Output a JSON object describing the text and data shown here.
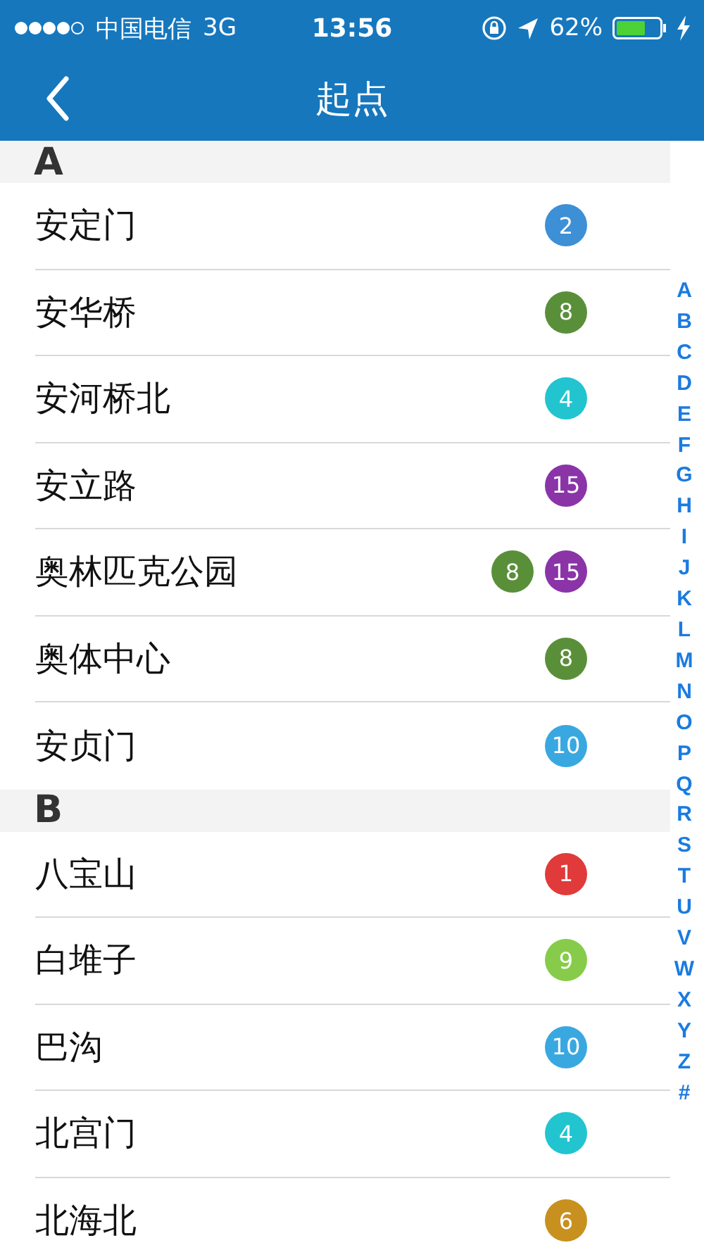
{
  "status_bar": {
    "carrier": "中国电信",
    "network": "3G",
    "time": "13:56",
    "battery": "62%"
  },
  "nav": {
    "title": "起点"
  },
  "sections": [
    {
      "letter": "A",
      "stations": [
        {
          "name": "安定门",
          "lines": [
            {
              "label": "2",
              "color": "#3d8fd6"
            }
          ]
        },
        {
          "name": "安华桥",
          "lines": [
            {
              "label": "8",
              "color": "#5a8f3a"
            }
          ]
        },
        {
          "name": "安河桥北",
          "lines": [
            {
              "label": "4",
              "color": "#22c4cf"
            }
          ]
        },
        {
          "name": "安立路",
          "lines": [
            {
              "label": "15",
              "color": "#8a34a8"
            }
          ]
        },
        {
          "name": "奥林匹克公园",
          "lines": [
            {
              "label": "8",
              "color": "#5a8f3a"
            },
            {
              "label": "15",
              "color": "#8a34a8"
            }
          ]
        },
        {
          "name": "奥体中心",
          "lines": [
            {
              "label": "8",
              "color": "#5a8f3a"
            }
          ]
        },
        {
          "name": "安贞门",
          "lines": [
            {
              "label": "10",
              "color": "#3aa8e0"
            }
          ]
        }
      ]
    },
    {
      "letter": "B",
      "stations": [
        {
          "name": "八宝山",
          "lines": [
            {
              "label": "1",
              "color": "#e03a3a"
            }
          ]
        },
        {
          "name": "白堆子",
          "lines": [
            {
              "label": "9",
              "color": "#86cc4a"
            }
          ]
        },
        {
          "name": "巴沟",
          "lines": [
            {
              "label": "10",
              "color": "#3aa8e0"
            }
          ]
        },
        {
          "name": "北宫门",
          "lines": [
            {
              "label": "4",
              "color": "#22c4cf"
            }
          ]
        },
        {
          "name": "北海北",
          "lines": [
            {
              "label": "6",
              "color": "#c8901e"
            }
          ]
        }
      ]
    }
  ],
  "index": [
    "A",
    "B",
    "C",
    "D",
    "E",
    "F",
    "G",
    "H",
    "I",
    "J",
    "K",
    "L",
    "M",
    "N",
    "O",
    "P",
    "Q",
    "R",
    "S",
    "T",
    "U",
    "V",
    "W",
    "X",
    "Y",
    "Z",
    "#"
  ]
}
